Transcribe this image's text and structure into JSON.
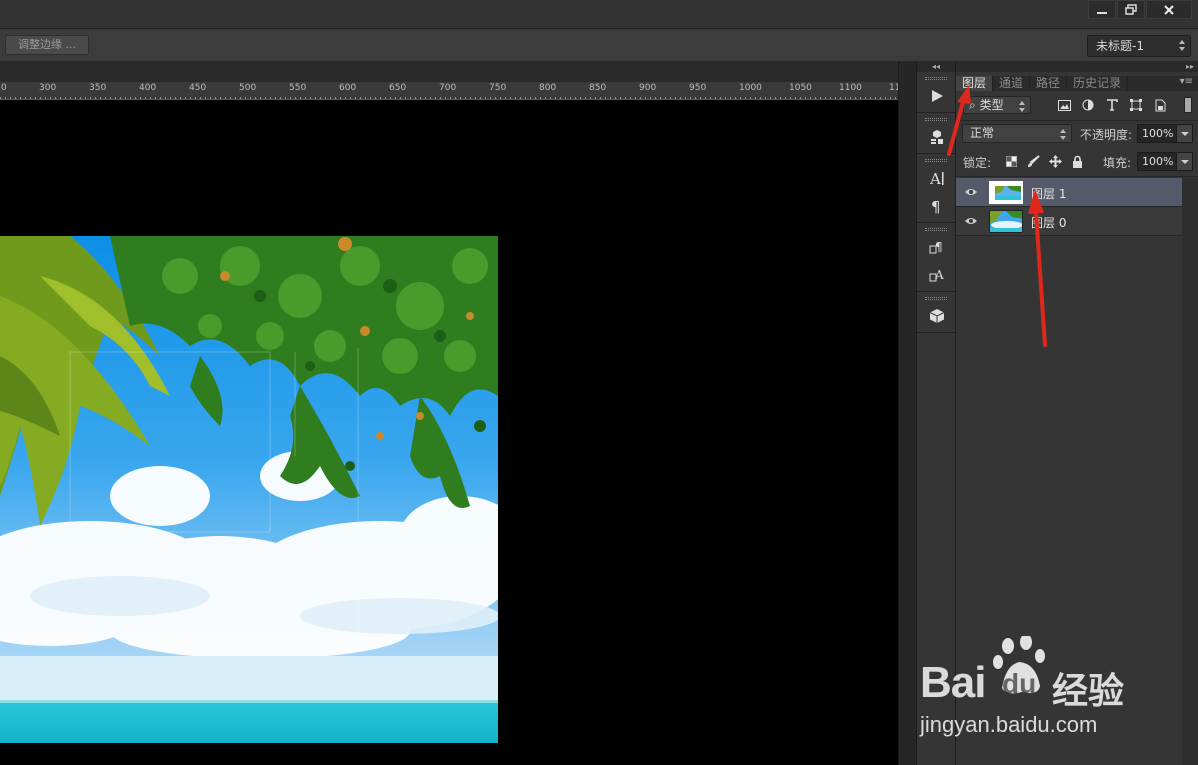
{
  "window": {
    "minimize_icon": "minimize-icon",
    "restore_icon": "restore-icon",
    "close_icon": "close-icon"
  },
  "options_bar": {
    "refine_edge_button": "调整边缘 ...",
    "document_select": "未标题-1"
  },
  "ruler": {
    "labels": [
      "0",
      "300",
      "350",
      "400",
      "450",
      "500",
      "550",
      "600",
      "650",
      "700",
      "750",
      "800",
      "850",
      "900",
      "950",
      "1000",
      "1050",
      "1100",
      "11"
    ]
  },
  "dock": {
    "top_arrow": "◂◂",
    "icons": [
      "play-icon",
      "3d-layers-icon",
      "character-icon",
      "paragraph-icon",
      "paragraph-styles-icon",
      "character-styles-icon",
      "3d-cube-icon"
    ]
  },
  "layers_panel": {
    "top_arrow": "▸▸",
    "tabs": [
      {
        "label": "图层",
        "active": true
      },
      {
        "label": "通道",
        "active": false
      },
      {
        "label": "路径",
        "active": false
      },
      {
        "label": "历史记录",
        "active": false
      }
    ],
    "panel_menu": "▾≡",
    "filter_kind": "类型",
    "filter_search_glyph": "⌕",
    "blend_mode": "正常",
    "opacity_label": "不透明度:",
    "opacity_value": "100%",
    "lock_label": "锁定:",
    "fill_label": "填充:",
    "fill_value": "100%",
    "layers": [
      {
        "name": "图层 1",
        "selected": true,
        "visible": true
      },
      {
        "name": "图层 0",
        "selected": false,
        "visible": true
      }
    ]
  },
  "annotations": {
    "arrow_color": "#e0271b"
  },
  "watermark": {
    "brand": "Bai",
    "brand_du": "du",
    "brand_cn": "经验",
    "url": "jingyan.baidu.com"
  },
  "colors": {
    "selected_layer": "#55596a",
    "panel_bg": "#353535",
    "options_bar_bg": "#3c3c3c"
  }
}
